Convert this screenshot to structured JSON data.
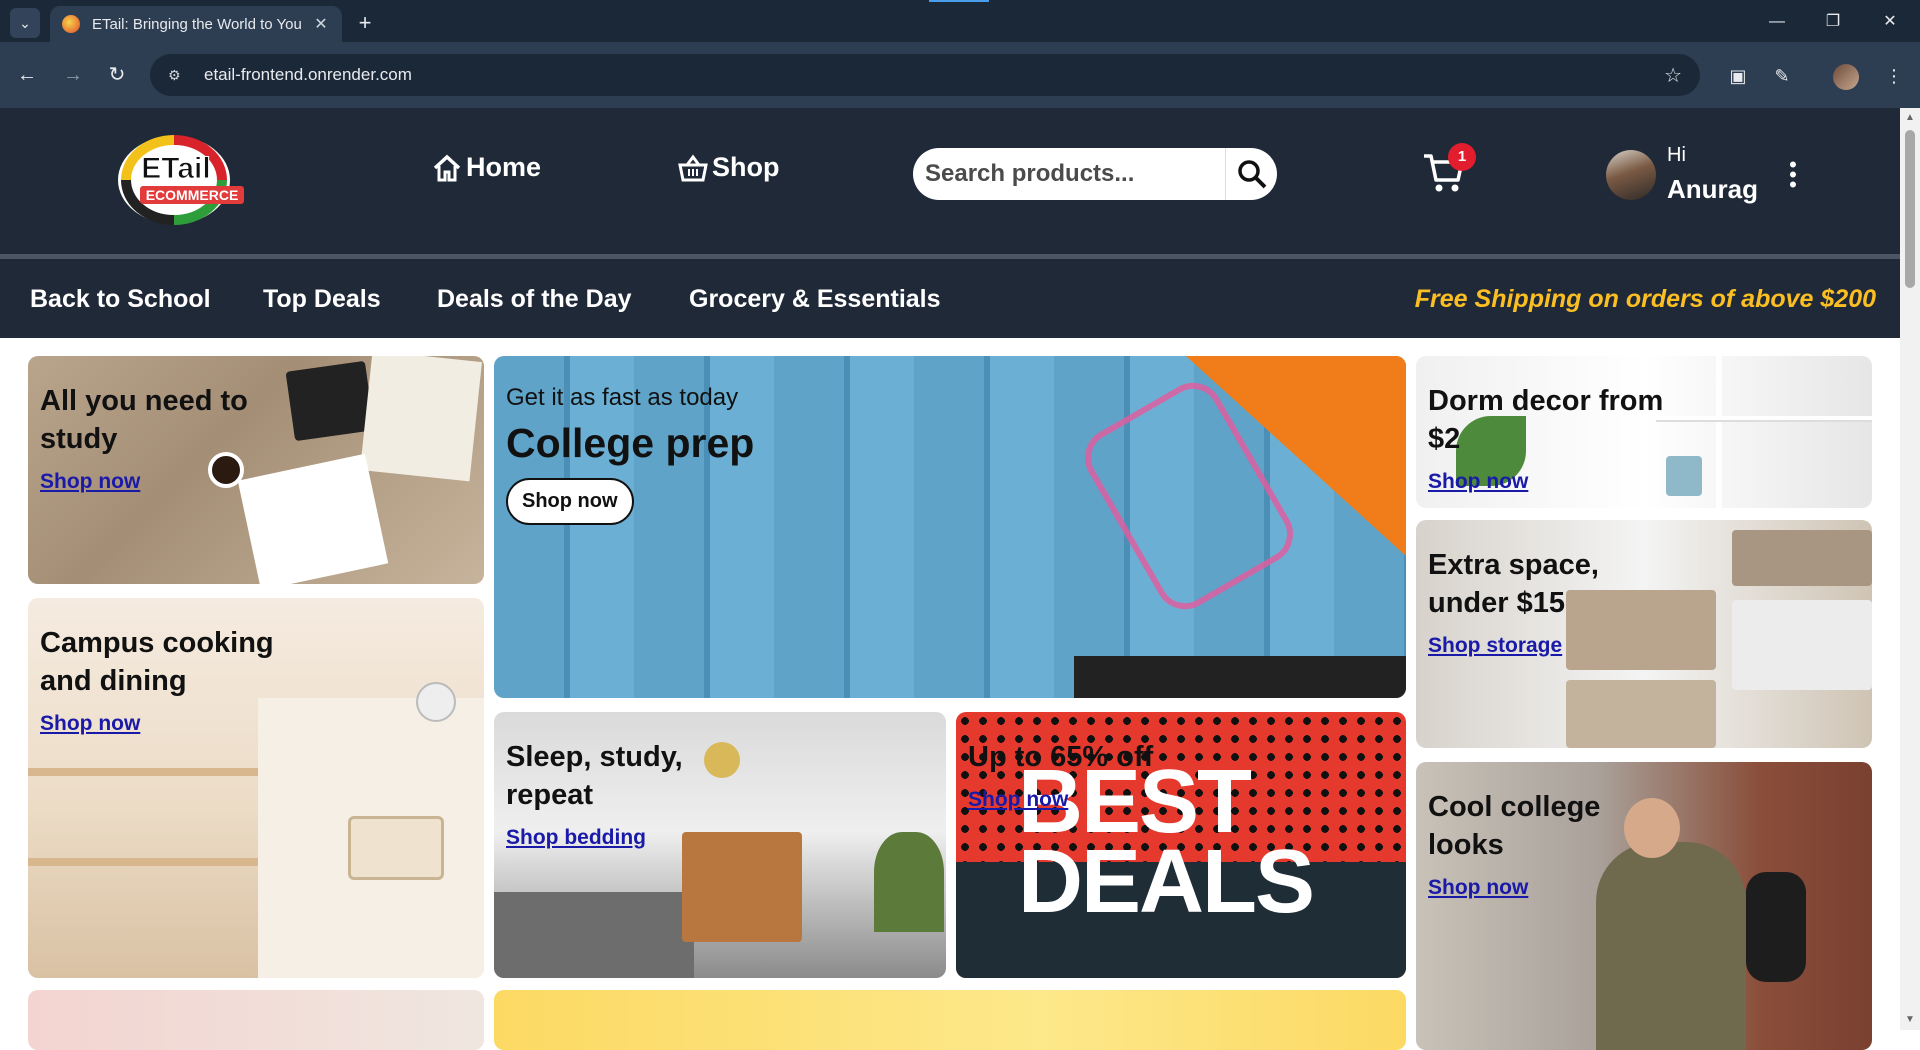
{
  "browser": {
    "tab_title": "ETail: Bringing the World to You",
    "url": "etail-frontend.onrender.com"
  },
  "header": {
    "logo_text": "ETail ECOMMERCE",
    "nav": [
      {
        "label": "Home",
        "icon": "home-icon"
      },
      {
        "label": "Shop",
        "icon": "basket-icon"
      }
    ],
    "search_placeholder": "Search products...",
    "cart_count": "1",
    "greeting": "Hi",
    "user_name": "Anurag"
  },
  "categories": [
    "Back to School",
    "Top Deals",
    "Deals of the Day",
    "Grocery & Essentials"
  ],
  "promo_text": "Free Shipping on orders of above $200",
  "cards": {
    "study": {
      "title": "All you need to study",
      "link": "Shop now"
    },
    "cooking": {
      "title": "Campus cooking and dining",
      "link": "Shop now"
    },
    "prep": {
      "subtitle": "Get it as fast as today",
      "title": "College prep",
      "button": "Shop now"
    },
    "sleep": {
      "title": "Sleep, study, repeat",
      "link": "Shop bedding"
    },
    "deals": {
      "title": "Up to 65% off",
      "link": "Shop now",
      "banner": "BEST DEALS"
    },
    "dorm": {
      "title": "Dorm decor from $2",
      "link": "Shop now"
    },
    "space": {
      "title": "Extra space, under $15",
      "link": "Shop storage"
    },
    "looks": {
      "title": "Cool college looks",
      "link": "Shop now"
    }
  },
  "colors": {
    "header_bg": "#1f2937",
    "promo": "#fbbf24",
    "badge": "#e11d2e",
    "link": "#1a1aa8"
  }
}
